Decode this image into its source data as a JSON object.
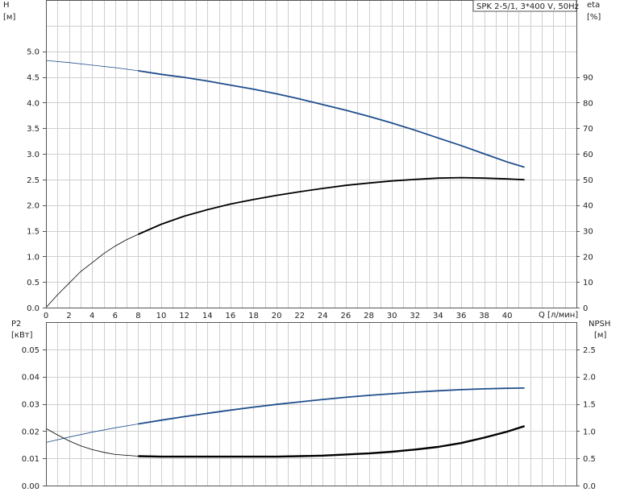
{
  "label_box": "SPK 2-5/1, 3*400 V, 50Hz",
  "colors": {
    "blue": "#1f4e8c",
    "black": "#000000",
    "grid": "#cfcfcf"
  },
  "chart_data": [
    {
      "type": "line",
      "xlabel": "Q [л/мин]",
      "ylabel_left": "H",
      "ylabel_left_unit": "[м]",
      "ylabel_right": "eta",
      "ylabel_right_unit": "[%]",
      "x_ticks": [
        0,
        2,
        4,
        6,
        8,
        10,
        12,
        14,
        16,
        18,
        20,
        22,
        24,
        26,
        28,
        30,
        32,
        34,
        36,
        38,
        40
      ],
      "x_tick_labels": [
        "0",
        "2",
        "4",
        "6",
        "8",
        "10",
        "12",
        "14",
        "16",
        "18",
        "20",
        "22",
        "24",
        "26",
        "28",
        "30",
        "32",
        "34",
        "36",
        "38",
        "40"
      ],
      "xlim": [
        0,
        46
      ],
      "ylim_left": [
        0,
        6
      ],
      "left_ticks": [
        0,
        0.5,
        1,
        1.5,
        2,
        2.5,
        3,
        3.5,
        4,
        4.5,
        5
      ],
      "left_tick_labels": [
        "0.0",
        "0.5",
        "1.0",
        "1.5",
        "2.0",
        "2.5",
        "3.0",
        "3.5",
        "4.0",
        "4.5",
        "5.0"
      ],
      "ylim_right": [
        0,
        120
      ],
      "right_ticks": [
        0,
        10,
        20,
        30,
        40,
        50,
        60,
        70,
        80,
        90
      ],
      "right_tick_labels": [
        "0",
        "10",
        "20",
        "30",
        "40",
        "50",
        "60",
        "70",
        "80",
        "90"
      ],
      "grid": true,
      "series": [
        {
          "axis": "left",
          "color": "blue",
          "x": [
            0,
            2,
            4,
            6,
            8,
            10,
            12,
            14,
            16,
            18,
            20,
            22,
            24,
            26,
            28,
            30,
            32,
            34,
            36,
            38,
            40,
            41.5
          ],
          "y": [
            4.82,
            4.78,
            4.73,
            4.68,
            4.62,
            4.55,
            4.49,
            4.42,
            4.34,
            4.26,
            4.17,
            4.07,
            3.96,
            3.85,
            3.73,
            3.6,
            3.46,
            3.31,
            3.16,
            3.0,
            2.84,
            2.74
          ]
        },
        {
          "axis": "right",
          "color": "black",
          "x": [
            0,
            1,
            2,
            3,
            4,
            5,
            6,
            7,
            8,
            10,
            12,
            14,
            16,
            18,
            20,
            22,
            24,
            26,
            28,
            30,
            32,
            34,
            36,
            38,
            40,
            41.5
          ],
          "y": [
            0,
            5,
            9.5,
            14,
            17.5,
            21,
            24,
            26.5,
            28.6,
            32.5,
            35.7,
            38.2,
            40.4,
            42.2,
            43.8,
            45.2,
            46.5,
            47.7,
            48.6,
            49.4,
            50.0,
            50.5,
            50.7,
            50.5,
            50.2,
            49.9
          ]
        }
      ]
    },
    {
      "type": "line",
      "ylabel_left": "P2",
      "ylabel_left_unit": "[кВт]",
      "ylabel_right": "NPSH",
      "ylabel_right_unit": "[м]",
      "xlim": [
        0,
        46
      ],
      "ylim_left": [
        0,
        0.06
      ],
      "left_ticks": [
        0,
        0.01,
        0.02,
        0.03,
        0.04,
        0.05
      ],
      "left_tick_labels": [
        "0.00",
        "0.01",
        "0.02",
        "0.03",
        "0.04",
        "0.05"
      ],
      "ylim_right": [
        0,
        3
      ],
      "right_ticks": [
        0,
        0.5,
        1,
        1.5,
        2,
        2.5
      ],
      "right_tick_labels": [
        "0.0",
        "0.5",
        "1.0",
        "1.5",
        "2.0",
        "2.5"
      ],
      "grid": true,
      "series": [
        {
          "axis": "left",
          "color": "blue",
          "x": [
            0,
            2,
            4,
            6,
            8,
            10,
            12,
            14,
            16,
            18,
            20,
            22,
            24,
            26,
            28,
            30,
            32,
            34,
            36,
            38,
            40,
            41.5
          ],
          "y": [
            0.0158,
            0.0178,
            0.0196,
            0.0212,
            0.0226,
            0.024,
            0.0253,
            0.0265,
            0.0277,
            0.0288,
            0.0298,
            0.0307,
            0.0316,
            0.0324,
            0.0331,
            0.0337,
            0.0343,
            0.0348,
            0.0352,
            0.0355,
            0.0357,
            0.0358
          ]
        },
        {
          "axis": "right",
          "color": "black",
          "x": [
            0,
            1,
            2,
            3,
            4,
            5,
            6,
            8,
            10,
            12,
            14,
            16,
            18,
            20,
            22,
            24,
            26,
            28,
            30,
            32,
            34,
            36,
            38,
            40,
            41.5
          ],
          "y": [
            1.05,
            0.93,
            0.82,
            0.73,
            0.66,
            0.61,
            0.57,
            0.54,
            0.53,
            0.53,
            0.53,
            0.53,
            0.53,
            0.53,
            0.54,
            0.55,
            0.57,
            0.59,
            0.62,
            0.66,
            0.71,
            0.78,
            0.88,
            0.99,
            1.09
          ]
        }
      ]
    }
  ]
}
